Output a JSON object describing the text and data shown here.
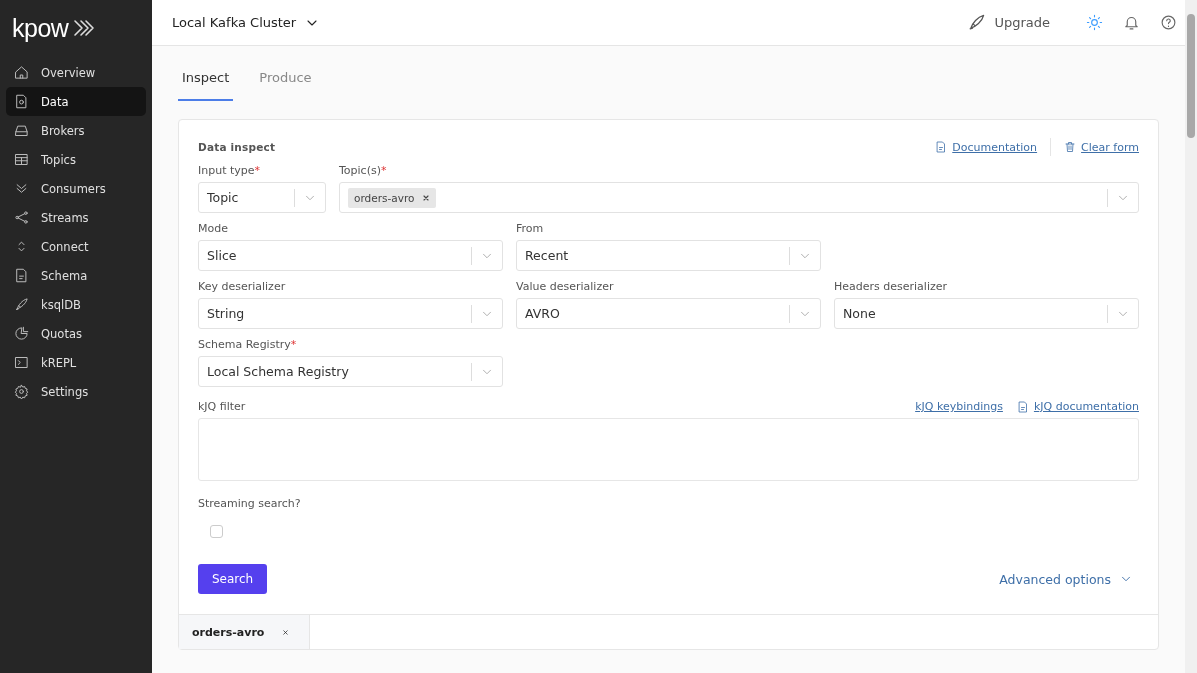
{
  "sidebar": {
    "logo": "kpow",
    "items": [
      {
        "label": "Overview",
        "selected": false
      },
      {
        "label": "Data",
        "selected": true
      },
      {
        "label": "Brokers",
        "selected": false
      },
      {
        "label": "Topics",
        "selected": false
      },
      {
        "label": "Consumers",
        "selected": false
      },
      {
        "label": "Streams",
        "selected": false
      },
      {
        "label": "Connect",
        "selected": false
      },
      {
        "label": "Schema",
        "selected": false
      },
      {
        "label": "ksqlDB",
        "selected": false
      },
      {
        "label": "Quotas",
        "selected": false
      },
      {
        "label": "kREPL",
        "selected": false
      },
      {
        "label": "Settings",
        "selected": false
      }
    ]
  },
  "header": {
    "cluster": "Local Kafka Cluster",
    "upgrade": "Upgrade"
  },
  "tabs": [
    {
      "label": "Inspect",
      "selected": true
    },
    {
      "label": "Produce",
      "selected": false
    }
  ],
  "form": {
    "title": "Data inspect",
    "links": [
      {
        "label": "Documentation"
      },
      {
        "label": "Clear form"
      }
    ],
    "rows": [
      [
        {
          "label": "Input type",
          "required_mark": "*",
          "kind": "select",
          "value": "Topic"
        },
        {
          "label": "Topic(s)",
          "required_mark": "*",
          "kind": "multi",
          "chips": [
            "orders-avro"
          ]
        }
      ],
      [
        {
          "label": "Mode",
          "kind": "select",
          "value": "Slice"
        },
        {
          "label": "From",
          "kind": "select",
          "value": "Recent"
        }
      ],
      [
        {
          "label": "Key deserializer",
          "kind": "select",
          "value": "String"
        },
        {
          "label": "Value deserializer",
          "kind": "select",
          "value": "AVRO"
        },
        {
          "label": "Headers deserializer",
          "kind": "select",
          "value": "None"
        }
      ],
      [
        {
          "label": "Schema Registry",
          "required_mark": "*",
          "kind": "select",
          "value": "Local Schema Registry"
        }
      ]
    ],
    "filter": {
      "label": "kJQ filter",
      "links": [
        {
          "label": "kJQ keybindings"
        },
        {
          "label": "kJQ documentation"
        }
      ]
    },
    "streaming": {
      "label": "Streaming search?",
      "checked": false
    },
    "search_button": "Search",
    "advanced": "Advanced options"
  },
  "result_tabs": [
    {
      "label": "orders-avro"
    }
  ]
}
